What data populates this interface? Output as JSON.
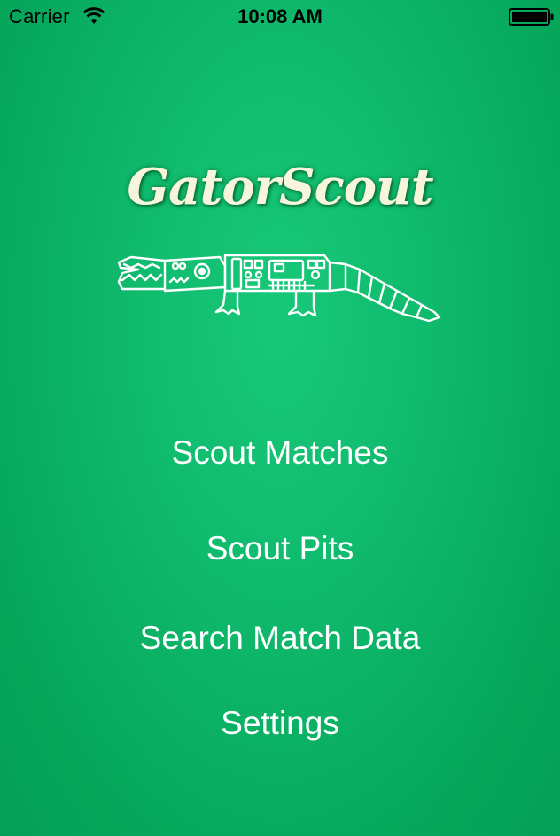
{
  "status_bar": {
    "carrier": "Carrier",
    "time": "10:08 AM",
    "icons": [
      "wifi-icon",
      "battery-icon"
    ]
  },
  "logo": {
    "title": "GatorScout",
    "image": "gator-robot-logo"
  },
  "menu": {
    "items": [
      {
        "label": "Scout Matches"
      },
      {
        "label": "Scout Pits"
      },
      {
        "label": "Search Match Data"
      },
      {
        "label": "Settings"
      }
    ]
  },
  "colors": {
    "background": "#10bb6e",
    "background_edge": "#049f57",
    "text": "#ffffff",
    "logo_text": "#f7f5dc",
    "status_text": "#000000"
  }
}
